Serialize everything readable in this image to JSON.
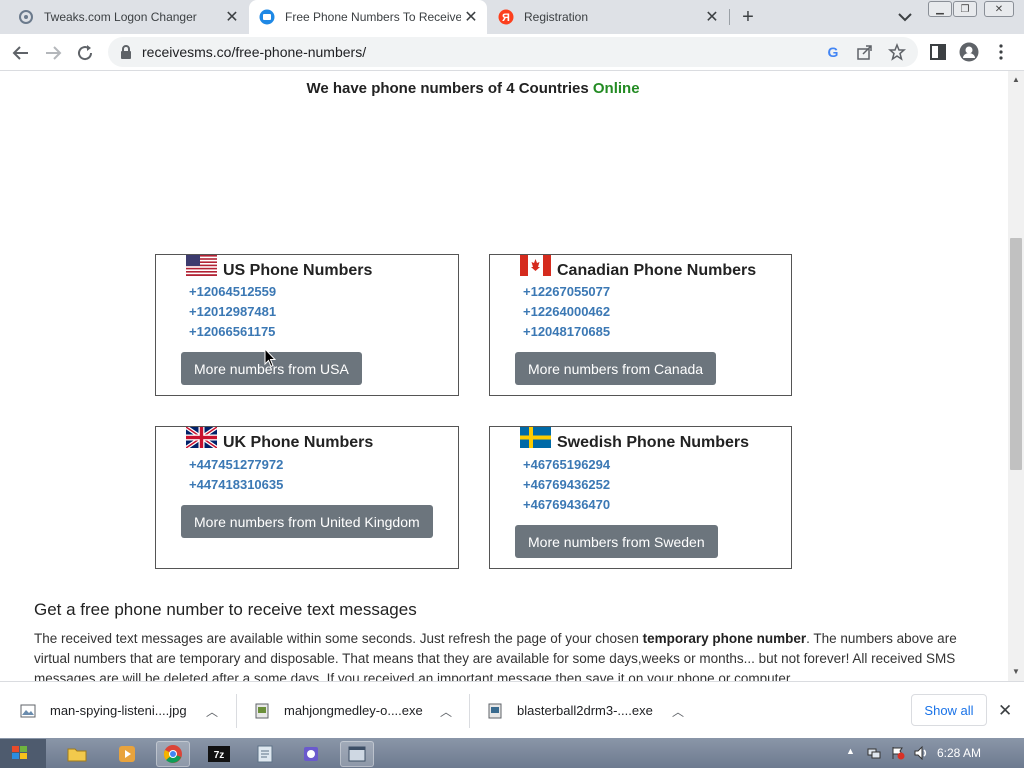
{
  "tabs": [
    {
      "title": "Tweaks.com Logon Changer",
      "icon": "tweaks-favicon"
    },
    {
      "title": "Free Phone Numbers To Receive",
      "icon": "receivesms-favicon"
    },
    {
      "title": "Registration",
      "icon": "yandex-favicon"
    }
  ],
  "address": {
    "url": "receivesms.co/free-phone-numbers/"
  },
  "page": {
    "countries_text": "We have phone numbers of 4 Countries",
    "online_text": "Online",
    "cards": [
      {
        "title": "US Phone Numbers",
        "numbers": [
          "+12064512559",
          "+12012987481",
          "+12066561175"
        ],
        "button": "More numbers from USA",
        "flag": "us-flag"
      },
      {
        "title": "Canadian Phone Numbers",
        "numbers": [
          "+12267055077",
          "+12264000462",
          "+12048170685"
        ],
        "button": "More numbers from Canada",
        "flag": "canada-flag"
      },
      {
        "title": "UK Phone Numbers",
        "numbers": [
          "+447451277972",
          "+447418310635"
        ],
        "button": "More numbers from United Kingdom",
        "flag": "uk-flag"
      },
      {
        "title": "Swedish Phone Numbers",
        "numbers": [
          "+46765196294",
          "+46769436252",
          "+46769436470"
        ],
        "button": "More numbers from Sweden",
        "flag": "sweden-flag"
      }
    ],
    "heading": "Get a free phone number to receive text messages",
    "paragraph": {
      "p1": "The received text messages are available within some seconds. Just refresh the page of your chosen ",
      "bold": "temporary phone number",
      "p2": ". The numbers above are virtual numbers that are temporary and disposable. That means that they are available for some days,weeks or months... but not forever! All received SMS messages are will be deleted after a some days. If you received an important message then save it on your phone or computer."
    }
  },
  "downloads": {
    "items": [
      "man-spying-listeni....jpg",
      "mahjongmedley-o....exe",
      "blasterball2drm3-....exe"
    ],
    "show_all": "Show all"
  },
  "taskbar": {
    "clock": "6:28 AM"
  },
  "colors": {
    "online": "#238b23",
    "phone_link": "#3b78b4",
    "button_bg": "#6c757d",
    "tab_strip": "#dee1e6"
  }
}
